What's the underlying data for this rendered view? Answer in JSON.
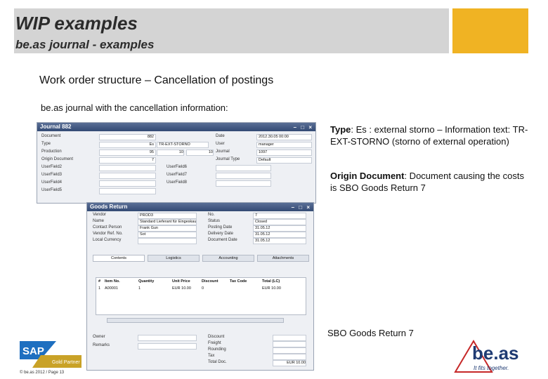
{
  "header": {
    "title": "WIP examples",
    "subtitle": "be.as journal - examples"
  },
  "main": {
    "section_title": "Work order structure – Cancellation of postings",
    "intro": "be.as journal with the cancellation information:"
  },
  "notes": {
    "type_label": "Type",
    "type_text": ": Es : external storno – Information text: TR-EXT-STORNO (storno of external operation)",
    "origin_label": "Origin Document",
    "origin_text": ": Document causing the costs is SBO Goods Return 7",
    "caption": "SBO Goods Return 7"
  },
  "journal_window": {
    "title": "Journal 882",
    "fields_left": [
      {
        "label": "Document",
        "value": "882"
      },
      {
        "label": "Type",
        "value": "Es"
      },
      {
        "label": "Production",
        "value": "95"
      },
      {
        "label": "Origin Document",
        "value": "7"
      },
      {
        "label": "UserField2",
        "value": ""
      },
      {
        "label": "UserField3",
        "value": ""
      },
      {
        "label": "UserField4",
        "value": ""
      },
      {
        "label": "UserField5",
        "value": ""
      }
    ],
    "type_info": "TR-EXT-STORNO",
    "prod_a": "10",
    "prod_b": "10",
    "fields_right": [
      {
        "label": "Date",
        "value": "2012.30.05 00:00"
      },
      {
        "label": "User",
        "value": "manager"
      },
      {
        "label": "Journal",
        "value": "1097"
      },
      {
        "label": "Journal Type",
        "value": "Default"
      }
    ],
    "fields_mid": [
      {
        "label": "UserField6",
        "value": ""
      },
      {
        "label": "UserField7",
        "value": ""
      },
      {
        "label": "UserField8",
        "value": ""
      }
    ]
  },
  "goods_window": {
    "title": "Goods Return",
    "top_fields": [
      "Vendor",
      "Name",
      "Contact Person",
      "Vendor Ref. No.",
      "Local Currency"
    ],
    "top_values": [
      "PROD3",
      "Standard Lieferant für Eingeskauft",
      "Frank Gun",
      "Sot",
      ""
    ],
    "right_fields": [
      "No.",
      "Status",
      "Posting Date",
      "Delivery Date",
      "Document Date"
    ],
    "right_values": [
      "7",
      "Closed",
      "31.05.12",
      "31.05.12",
      "31.05.12"
    ],
    "tabs": [
      "Contents",
      "Logistics",
      "Accounting",
      "Attachments"
    ],
    "grid_headers": [
      "#",
      "Item No.",
      "Quantity",
      "Unit Price",
      "Discount",
      "Tax Code",
      "Total (LC)"
    ],
    "grid_row": [
      "1",
      "A00001",
      "1",
      "EUR 10.00",
      "0",
      "",
      "EUR 10.00"
    ],
    "bottom_fields": [
      "Owner",
      "Remarks"
    ],
    "totals": [
      "Discount",
      "Freight",
      "Rounding",
      "Tax",
      "Total Doc."
    ],
    "totals_values": [
      "",
      "",
      "",
      "",
      "EUR 10.00"
    ]
  },
  "footer": {
    "copyright": "© be.as 2012 / Page 13"
  },
  "logos": {
    "sap": "SAP",
    "sap_badge": "Gold Partner",
    "beas": "be.as",
    "beas_tagline": "It fits together."
  },
  "colors": {
    "accent": "#f0b323",
    "header_bg": "#d4d4d4",
    "sap_blue": "#1e6fc0",
    "beas_red": "#c62828"
  }
}
